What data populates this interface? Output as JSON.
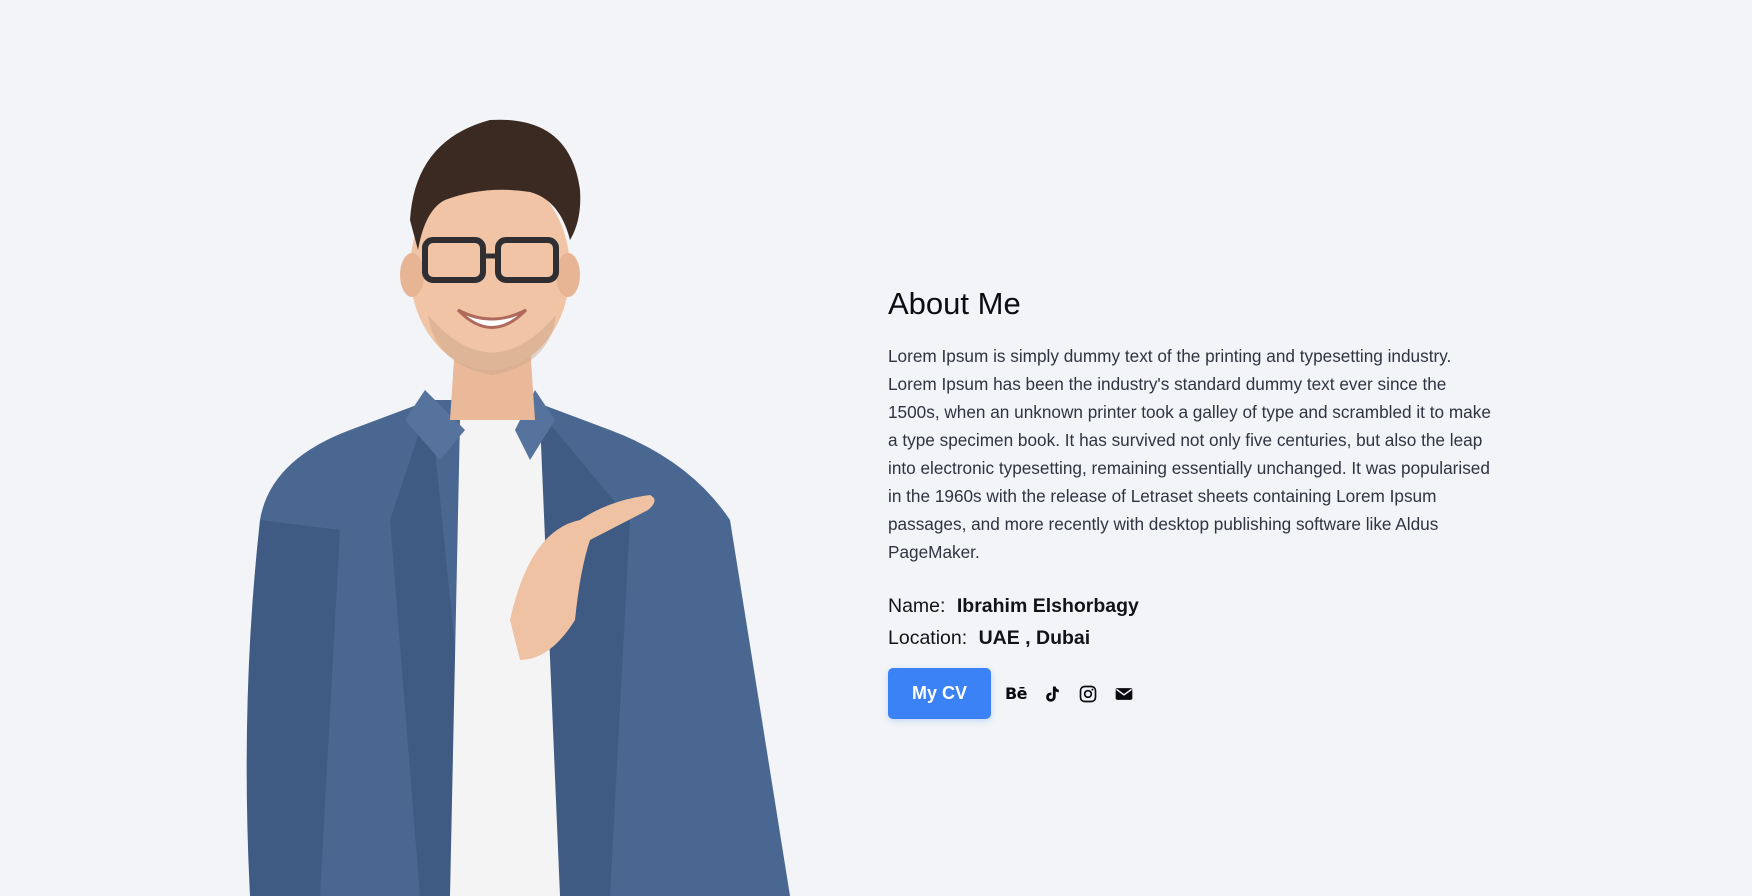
{
  "about": {
    "title": "About Me",
    "description": "Lorem Ipsum is simply dummy text of the printing and typesetting industry. Lorem Ipsum has been the industry's standard dummy text ever since the 1500s, when an unknown printer took a galley of type and scrambled it to make a type specimen book. It has survived not only five centuries, but also the leap into electronic typesetting, remaining essentially unchanged. It was popularised in the 1960s with the release of Letraset sheets containing Lorem Ipsum passages, and more recently with desktop publishing software like Aldus PageMaker.",
    "name_label": "Name:",
    "name_value": "Ibrahim Elshorbagy",
    "location_label": "Location:",
    "location_value": "UAE , Dubai"
  },
  "actions": {
    "cv_label": "My CV"
  },
  "socials": [
    {
      "name": "behance-icon",
      "glyph": "Bē"
    },
    {
      "name": "tiktok-icon"
    },
    {
      "name": "instagram-icon"
    },
    {
      "name": "email-icon"
    }
  ],
  "colors": {
    "background": "#f2f4f7",
    "accent": "#3b82f6",
    "text": "#0b0d12",
    "body_text": "#2f3440",
    "shirt": "#4a6791"
  }
}
